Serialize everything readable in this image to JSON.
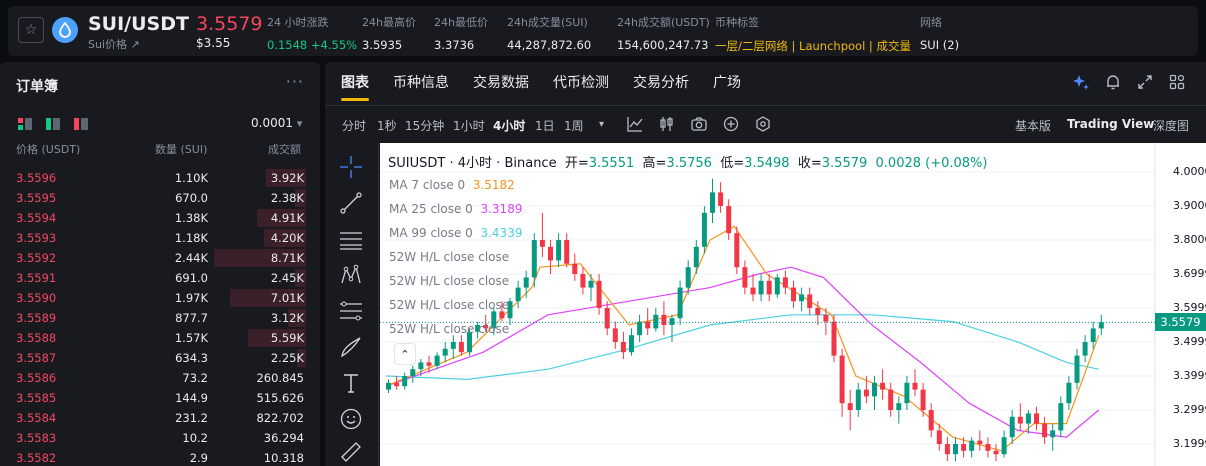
{
  "header": {
    "pair": "SUI/USDT",
    "sub_label": "Sui价格",
    "sub_arrow": "↗",
    "last_price": "3.5579",
    "last_price_usd": "$3.55",
    "stats": [
      {
        "label": "24 小时涨跌",
        "value": "0.1548 +4.55%",
        "color": "green"
      },
      {
        "label": "24h最高价",
        "value": "3.5935"
      },
      {
        "label": "24h最低价",
        "value": "3.3736"
      },
      {
        "label": "24h成交量(SUI)",
        "value": "44,287,872.60"
      },
      {
        "label": "24h成交额(USDT)",
        "value": "154,600,247.73"
      },
      {
        "label": "币种标签",
        "value": "一层/二层网络 | Launchpool | 成交量",
        "color": "gold"
      },
      {
        "label": "网络",
        "value": "SUI (2)"
      }
    ]
  },
  "orderbook": {
    "title": "订单簿",
    "more": "···",
    "precision": "0.0001",
    "precision_caret": "▾",
    "headers": {
      "price": "价格 (USDT)",
      "qty": "数量 (SUI)",
      "total": "成交额"
    },
    "rows": [
      {
        "price": "3.5596",
        "qty": "1.10K",
        "total": "3.92K",
        "depth": 0.22
      },
      {
        "price": "3.5595",
        "qty": "670.0",
        "total": "2.38K",
        "depth": 0.06
      },
      {
        "price": "3.5594",
        "qty": "1.38K",
        "total": "4.91K",
        "depth": 0.27
      },
      {
        "price": "3.5593",
        "qty": "1.18K",
        "total": "4.20K",
        "depth": 0.23
      },
      {
        "price": "3.5592",
        "qty": "2.44K",
        "total": "8.71K",
        "depth": 0.51
      },
      {
        "price": "3.5591",
        "qty": "691.0",
        "total": "2.45K",
        "depth": 0.06
      },
      {
        "price": "3.5590",
        "qty": "1.97K",
        "total": "7.01K",
        "depth": 0.42
      },
      {
        "price": "3.5589",
        "qty": "877.7",
        "total": "3.12K",
        "depth": 0.1
      },
      {
        "price": "3.5588",
        "qty": "1.57K",
        "total": "5.59K",
        "depth": 0.32
      },
      {
        "price": "3.5587",
        "qty": "634.3",
        "total": "2.25K",
        "depth": 0.05
      },
      {
        "price": "3.5586",
        "qty": "73.2",
        "total": "260.845",
        "depth": 0
      },
      {
        "price": "3.5585",
        "qty": "144.9",
        "total": "515.626",
        "depth": 0
      },
      {
        "price": "3.5584",
        "qty": "231.2",
        "total": "822.702",
        "depth": 0
      },
      {
        "price": "3.5583",
        "qty": "10.2",
        "total": "36.294",
        "depth": 0
      },
      {
        "price": "3.5582",
        "qty": "2.9",
        "total": "10.318",
        "depth": 0
      }
    ]
  },
  "tabs": [
    "图表",
    "币种信息",
    "交易数据",
    "代币检测",
    "交易分析",
    "广场"
  ],
  "timeframes": [
    "分时",
    "1秒",
    "15分钟",
    "1小时",
    "4小时",
    "1日",
    "1周"
  ],
  "timeframe_more": "▾",
  "views": [
    "基本版",
    "Trading View",
    "深度图"
  ],
  "chart": {
    "title_symbol": "SUIUSDT",
    "title_interval": "4小时",
    "title_exchange": "Binance",
    "dot": "·",
    "open_label": "开=",
    "open": "3.5551",
    "high_label": "高=",
    "high": "3.5756",
    "low_label": "低=",
    "low": "3.5498",
    "close_label": "收=",
    "close": "3.5579",
    "change": "0.0028 (+0.08%)",
    "indicators": [
      {
        "label": "MA 7 close 0",
        "value": "3.5182",
        "color": "#f7931a"
      },
      {
        "label": "MA 25 close 0",
        "value": "3.3189",
        "color": "#e040fb"
      },
      {
        "label": "MA 99 close 0",
        "value": "3.4339",
        "color": "#4dd0e1"
      },
      {
        "label": "52W H/L close close",
        "value": ""
      },
      {
        "label": "52W H/L close close",
        "value": ""
      },
      {
        "label": "52W H/L close close",
        "value": ""
      },
      {
        "label": "52W H/L close close",
        "value": ""
      }
    ],
    "collapse_icon": "⌃",
    "y_ticks": [
      "4.0000",
      "3.9000",
      "3.8000",
      "3.6999",
      "3.5999",
      "3.4999",
      "3.3999",
      "3.2999",
      "3.1999"
    ],
    "current_price_badge": "3.5579",
    "colors": {
      "up": "#089981",
      "down": "#f23645",
      "ma7": "#f7931a",
      "ma25": "#e040fb",
      "ma99": "#4dd0e1"
    }
  },
  "chart_data": {
    "type": "candlestick",
    "symbol": "SUIUSDT",
    "interval": "4小时",
    "ylim": [
      3.14,
      4.08
    ],
    "ohlc": [
      [
        3.36,
        3.39,
        3.35,
        3.38
      ],
      [
        3.38,
        3.4,
        3.36,
        3.37
      ],
      [
        3.37,
        3.41,
        3.36,
        3.4
      ],
      [
        3.4,
        3.43,
        3.38,
        3.42
      ],
      [
        3.42,
        3.45,
        3.4,
        3.44
      ],
      [
        3.44,
        3.46,
        3.41,
        3.43
      ],
      [
        3.43,
        3.47,
        3.42,
        3.46
      ],
      [
        3.46,
        3.5,
        3.44,
        3.48
      ],
      [
        3.48,
        3.52,
        3.45,
        3.5
      ],
      [
        3.5,
        3.52,
        3.46,
        3.47
      ],
      [
        3.47,
        3.54,
        3.46,
        3.53
      ],
      [
        3.53,
        3.56,
        3.51,
        3.55
      ],
      [
        3.55,
        3.58,
        3.53,
        3.54
      ],
      [
        3.54,
        3.6,
        3.52,
        3.59
      ],
      [
        3.59,
        3.62,
        3.56,
        3.57
      ],
      [
        3.57,
        3.63,
        3.55,
        3.62
      ],
      [
        3.62,
        3.68,
        3.6,
        3.66
      ],
      [
        3.66,
        3.71,
        3.63,
        3.69
      ],
      [
        3.69,
        3.82,
        3.66,
        3.8
      ],
      [
        3.8,
        3.88,
        3.75,
        3.78
      ],
      [
        3.78,
        3.8,
        3.7,
        3.74
      ],
      [
        3.74,
        3.82,
        3.72,
        3.8
      ],
      [
        3.8,
        3.82,
        3.72,
        3.73
      ],
      [
        3.73,
        3.76,
        3.68,
        3.7
      ],
      [
        3.7,
        3.72,
        3.64,
        3.66
      ],
      [
        3.66,
        3.7,
        3.62,
        3.68
      ],
      [
        3.68,
        3.7,
        3.58,
        3.6
      ],
      [
        3.6,
        3.62,
        3.52,
        3.54
      ],
      [
        3.54,
        3.56,
        3.48,
        3.5
      ],
      [
        3.5,
        3.53,
        3.45,
        3.47
      ],
      [
        3.47,
        3.54,
        3.46,
        3.52
      ],
      [
        3.52,
        3.58,
        3.5,
        3.56
      ],
      [
        3.56,
        3.6,
        3.52,
        3.54
      ],
      [
        3.54,
        3.6,
        3.53,
        3.58
      ],
      [
        3.58,
        3.62,
        3.52,
        3.55
      ],
      [
        3.55,
        3.58,
        3.5,
        3.57
      ],
      [
        3.57,
        3.68,
        3.55,
        3.66
      ],
      [
        3.66,
        3.74,
        3.64,
        3.72
      ],
      [
        3.72,
        3.8,
        3.7,
        3.78
      ],
      [
        3.78,
        3.9,
        3.76,
        3.88
      ],
      [
        3.88,
        3.98,
        3.85,
        3.94
      ],
      [
        3.94,
        3.97,
        3.88,
        3.9
      ],
      [
        3.9,
        3.92,
        3.8,
        3.82
      ],
      [
        3.82,
        3.84,
        3.7,
        3.72
      ],
      [
        3.72,
        3.74,
        3.64,
        3.66
      ],
      [
        3.66,
        3.7,
        3.62,
        3.64
      ],
      [
        3.64,
        3.7,
        3.62,
        3.68
      ],
      [
        3.68,
        3.7,
        3.62,
        3.64
      ],
      [
        3.64,
        3.7,
        3.63,
        3.69
      ],
      [
        3.69,
        3.71,
        3.64,
        3.66
      ],
      [
        3.66,
        3.68,
        3.6,
        3.62
      ],
      [
        3.62,
        3.66,
        3.59,
        3.64
      ],
      [
        3.64,
        3.66,
        3.58,
        3.6
      ],
      [
        3.6,
        3.62,
        3.55,
        3.58
      ],
      [
        3.58,
        3.6,
        3.52,
        3.56
      ],
      [
        3.56,
        3.58,
        3.44,
        3.46
      ],
      [
        3.46,
        3.48,
        3.28,
        3.32
      ],
      [
        3.32,
        3.36,
        3.24,
        3.3
      ],
      [
        3.3,
        3.38,
        3.28,
        3.36
      ],
      [
        3.36,
        3.4,
        3.32,
        3.34
      ],
      [
        3.34,
        3.4,
        3.3,
        3.38
      ],
      [
        3.38,
        3.42,
        3.33,
        3.36
      ],
      [
        3.36,
        3.38,
        3.28,
        3.3
      ],
      [
        3.3,
        3.34,
        3.26,
        3.32
      ],
      [
        3.32,
        3.4,
        3.3,
        3.38
      ],
      [
        3.38,
        3.42,
        3.34,
        3.36
      ],
      [
        3.36,
        3.38,
        3.28,
        3.3
      ],
      [
        3.3,
        3.32,
        3.22,
        3.24
      ],
      [
        3.24,
        3.26,
        3.18,
        3.2
      ],
      [
        3.2,
        3.22,
        3.15,
        3.17
      ],
      [
        3.17,
        3.22,
        3.15,
        3.2
      ],
      [
        3.2,
        3.22,
        3.16,
        3.18
      ],
      [
        3.18,
        3.22,
        3.16,
        3.21
      ],
      [
        3.21,
        3.24,
        3.18,
        3.2
      ],
      [
        3.2,
        3.22,
        3.16,
        3.18
      ],
      [
        3.18,
        3.2,
        3.15,
        3.17
      ],
      [
        3.17,
        3.24,
        3.16,
        3.22
      ],
      [
        3.22,
        3.3,
        3.2,
        3.28
      ],
      [
        3.28,
        3.32,
        3.24,
        3.26
      ],
      [
        3.26,
        3.3,
        3.23,
        3.29
      ],
      [
        3.29,
        3.31,
        3.24,
        3.26
      ],
      [
        3.26,
        3.28,
        3.2,
        3.22
      ],
      [
        3.22,
        3.26,
        3.18,
        3.24
      ],
      [
        3.24,
        3.34,
        3.22,
        3.32
      ],
      [
        3.32,
        3.4,
        3.3,
        3.38
      ],
      [
        3.38,
        3.48,
        3.36,
        3.46
      ],
      [
        3.46,
        3.52,
        3.44,
        3.5
      ],
      [
        3.5,
        3.56,
        3.48,
        3.54
      ],
      [
        3.54,
        3.58,
        3.52,
        3.5579
      ]
    ],
    "ma7": [
      [
        0,
        3.37
      ],
      [
        10,
        3.47
      ],
      [
        18,
        3.66
      ],
      [
        19,
        3.72
      ],
      [
        24,
        3.73
      ],
      [
        30,
        3.55
      ],
      [
        36,
        3.58
      ],
      [
        40,
        3.8
      ],
      [
        43,
        3.84
      ],
      [
        47,
        3.7
      ],
      [
        55,
        3.58
      ],
      [
        58,
        3.4
      ],
      [
        64,
        3.34
      ],
      [
        70,
        3.22
      ],
      [
        76,
        3.18
      ],
      [
        80,
        3.26
      ],
      [
        84,
        3.26
      ],
      [
        88,
        3.52
      ]
    ],
    "ma25": [
      [
        0,
        3.37
      ],
      [
        12,
        3.47
      ],
      [
        20,
        3.58
      ],
      [
        30,
        3.62
      ],
      [
        40,
        3.66
      ],
      [
        46,
        3.7
      ],
      [
        50,
        3.72
      ],
      [
        54,
        3.69
      ],
      [
        60,
        3.55
      ],
      [
        66,
        3.44
      ],
      [
        72,
        3.32
      ],
      [
        78,
        3.24
      ],
      [
        84,
        3.22
      ],
      [
        88,
        3.3
      ]
    ],
    "ma99": [
      [
        0,
        3.4
      ],
      [
        10,
        3.39
      ],
      [
        20,
        3.42
      ],
      [
        30,
        3.48
      ],
      [
        40,
        3.55
      ],
      [
        50,
        3.58
      ],
      [
        60,
        3.58
      ],
      [
        70,
        3.56
      ],
      [
        78,
        3.5
      ],
      [
        84,
        3.44
      ],
      [
        88,
        3.42
      ]
    ]
  }
}
